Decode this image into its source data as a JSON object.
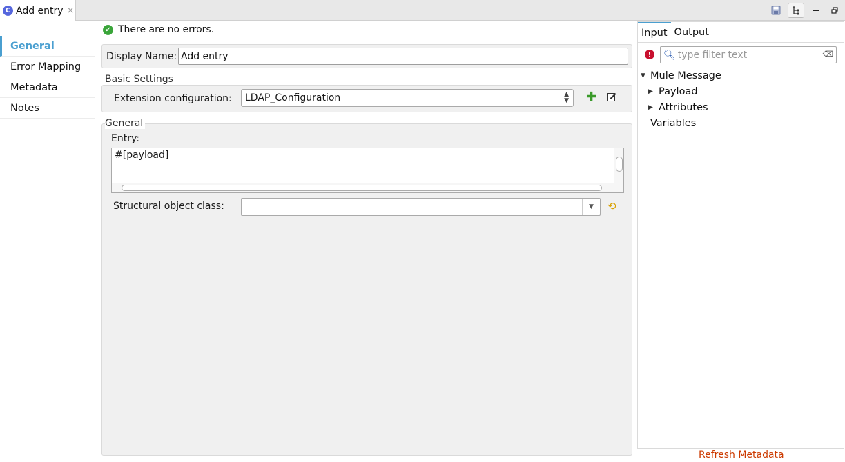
{
  "tab": {
    "title": "Add entry",
    "close": "×",
    "icon": "C"
  },
  "toolbar": {
    "save_icon": "save-icon",
    "tree_icon": "tree-icon",
    "minimize_icon": "minimize-icon",
    "restore_icon": "restore-icon"
  },
  "nav": {
    "items": [
      {
        "label": "General",
        "active": true
      },
      {
        "label": "Error Mapping",
        "active": false
      },
      {
        "label": "Metadata",
        "active": false
      },
      {
        "label": "Notes",
        "active": false
      }
    ]
  },
  "status": {
    "text": "There are no errors.",
    "icon": "check-circle-icon"
  },
  "display_name": {
    "label": "Display Name:",
    "value": "Add entry"
  },
  "basic_settings": {
    "title": "Basic Settings",
    "extension_label": "Extension configuration:",
    "extension_value": "LDAP_Configuration"
  },
  "general": {
    "title": "General",
    "entry_label": "Entry:",
    "entry_value": "#[payload]",
    "structural_label": "Structural object class:",
    "structural_value": ""
  },
  "right_panel": {
    "tabs": [
      "Input",
      "Output"
    ],
    "filter_placeholder": "type filter text",
    "tree": {
      "root": "Mule Message",
      "children": [
        "Payload",
        "Attributes"
      ],
      "variables": "Variables"
    }
  },
  "footer": {
    "refresh_label": "Refresh Metadata"
  },
  "colors": {
    "accent": "#4a9fd0",
    "link": "#cc3a00",
    "error": "#c8102e",
    "ok": "#3aa53a"
  }
}
